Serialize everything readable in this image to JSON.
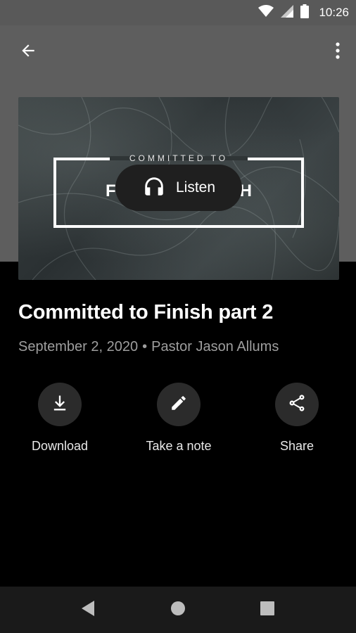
{
  "status_bar": {
    "time": "10:26",
    "icons": [
      "wifi-icon",
      "signal-icon",
      "battery-icon"
    ]
  },
  "app_bar": {
    "back_icon": "arrow-back-icon",
    "more_icon": "more-vert-icon"
  },
  "hero": {
    "artwork_top_text": "COMMITTED TO",
    "artwork_visible_letters": [
      "F",
      "H"
    ],
    "listen_label": "Listen",
    "listen_icon": "headphones-icon"
  },
  "sermon": {
    "title": "Committed to Finish part 2",
    "date": "September 2, 2020",
    "separator": "•",
    "speaker": "Pastor Jason Allums"
  },
  "actions": [
    {
      "label": "Download",
      "icon": "download-icon"
    },
    {
      "label": "Take a note",
      "icon": "pencil-icon"
    },
    {
      "label": "Share",
      "icon": "share-icon"
    }
  ],
  "nav_bar": {
    "icons": [
      "nav-back-icon",
      "nav-home-icon",
      "nav-recents-icon"
    ]
  },
  "colors": {
    "top_background": "#5e5e5e",
    "page_background": "#000000",
    "action_circle": "#2b2b2b",
    "meta_text": "#9e9e9e"
  }
}
